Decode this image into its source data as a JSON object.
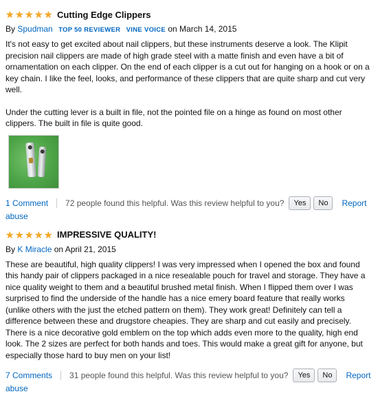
{
  "reviews": [
    {
      "stars": 5,
      "title": "Cutting Edge Clippers",
      "by": "By",
      "author": "Spudman",
      "badges": [
        "TOP 50 REVIEWER",
        "VINE VOICE"
      ],
      "date": "on March 14, 2015",
      "paragraphs": [
        "It's not easy to get excited about nail clippers, but these instruments deserve a look. The Klipit precision nail clippers are made of high grade steel with a matte finish and even have a bit of ornamentation on each clipper. On the end of each clipper is a cut out for hanging on a hook or on a key chain. I like the feel, looks, and performance of these clippers that are quite sharp and cut very well.",
        "Under the cutting lever is a built in file, not the pointed file on a hinge as found on most other clippers. The built in file is quite good."
      ],
      "comments": "1 Comment",
      "helpful": "72 people found this helpful. Was this review helpful to you?",
      "yes": "Yes",
      "no": "No",
      "report": "Report",
      "abuse": "abuse"
    },
    {
      "stars": 5,
      "title": "IMPRESSIVE QUALITY!",
      "by": "By",
      "author": "K Miracle",
      "date": "on April 21, 2015",
      "paragraphs": [
        "These are beautiful, high quality clippers! I was very impressed when I opened the box and found this handy pair of clippers packaged in a nice resealable pouch for travel and storage. They have a nice quality weight to them and a beautiful brushed metal finish. When I flipped them over I was surprised to find the underside of the handle has a nice emery board feature that really works (unlike others with the just the etched pattern on them). They work great! Definitely can tell a difference between these and drugstore cheapies. They are sharp and cut easily and precisely. There is a nice decorative gold emblem on the top which adds even more to the quality, high end look. The 2 sizes are perfect for both hands and toes. This would make a great gift for anyone, but especially those hard to buy men on your list!"
      ],
      "comments": "7 Comments",
      "helpful": "31 people found this helpful. Was this review helpful to you?",
      "yes": "Yes",
      "no": "No",
      "report": "Report",
      "abuse": "abuse"
    }
  ],
  "colors": {
    "link": "#0066c0",
    "star": "#f5a623",
    "text": "#111111",
    "muted": "#555555"
  }
}
